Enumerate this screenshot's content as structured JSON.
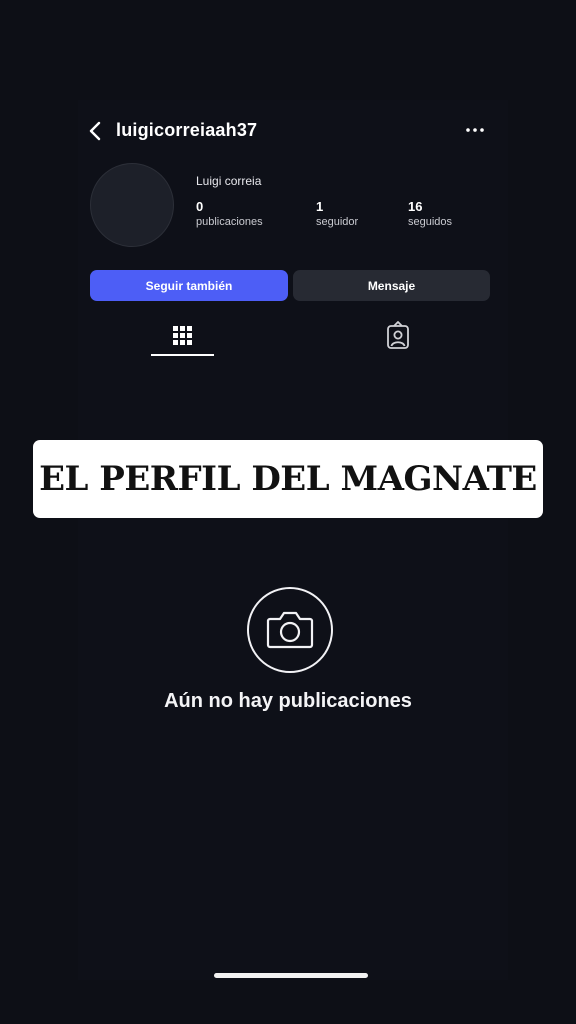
{
  "profile": {
    "username": "luigicorreiaah37",
    "display_name": "Luigi correia",
    "stats": [
      {
        "value": "0",
        "label": "publicaciones"
      },
      {
        "value": "1",
        "label": "seguidor"
      },
      {
        "value": "16",
        "label": "seguidos"
      }
    ]
  },
  "actions": {
    "follow_label": "Seguir también",
    "message_label": "Mensaje"
  },
  "tabs": [
    {
      "icon": "grid-icon",
      "active": true
    },
    {
      "icon": "tagged-person-icon",
      "active": false
    }
  ],
  "overlay": {
    "banner_text": "EL PERFIL DEL MAGNATE"
  },
  "empty_state": {
    "icon": "camera-icon",
    "text": "Aún no hay publicaciones"
  },
  "colors": {
    "background": "#0d0f16",
    "primary_button": "#4d5ef6",
    "secondary_button": "#272a33"
  }
}
